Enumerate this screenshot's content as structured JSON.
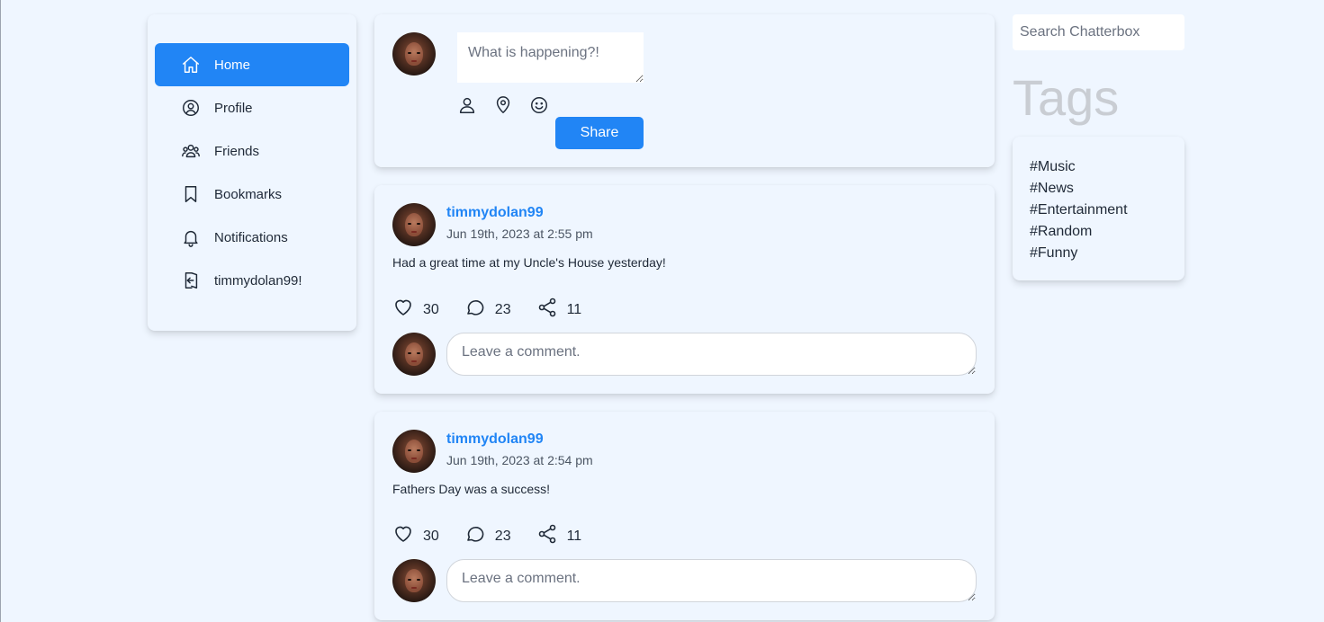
{
  "sidebar": {
    "items": [
      {
        "label": "Home",
        "icon": "home-icon",
        "active": true
      },
      {
        "label": "Profile",
        "icon": "user-circle-icon"
      },
      {
        "label": "Friends",
        "icon": "users-icon"
      },
      {
        "label": "Bookmarks",
        "icon": "bookmark-icon"
      },
      {
        "label": "Notifications",
        "icon": "bell-icon"
      },
      {
        "label": "timmydolan99!",
        "icon": "logout-icon"
      }
    ]
  },
  "composer": {
    "placeholder": "What is happening?!",
    "icons": [
      "user-icon",
      "map-pin-icon",
      "smile-icon"
    ],
    "share_label": "Share"
  },
  "posts": [
    {
      "username": "timmydolan99",
      "timestamp": "Jun 19th, 2023 at 2:55 pm",
      "content": "Had a great time at my Uncle's House yesterday!",
      "likes": "30",
      "comments": "23",
      "shares": "11",
      "comment_placeholder": "Leave a comment."
    },
    {
      "username": "timmydolan99",
      "timestamp": "Jun 19th, 2023 at 2:54 pm",
      "content": "Fathers Day was a success!",
      "likes": "30",
      "comments": "23",
      "shares": "11",
      "comment_placeholder": "Leave a comment."
    }
  ],
  "search": {
    "placeholder": "Search Chatterbox"
  },
  "tags": {
    "title": "Tags",
    "items": [
      "#Music",
      "#News",
      "#Entertainment",
      "#Random",
      "#Funny"
    ]
  },
  "colors": {
    "accent": "#2185f5",
    "background": "#eff6ff"
  }
}
